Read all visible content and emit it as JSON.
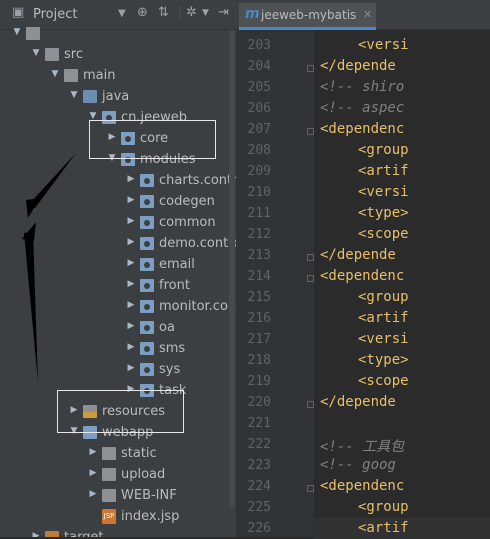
{
  "project_panel": {
    "title": "Project",
    "tree": [
      {
        "label": "",
        "indent": 0,
        "arrow": "down",
        "icon": "folder"
      },
      {
        "label": "src",
        "indent": 1,
        "arrow": "down",
        "icon": "folder"
      },
      {
        "label": "main",
        "indent": 2,
        "arrow": "down",
        "icon": "folder"
      },
      {
        "label": "java",
        "indent": 3,
        "arrow": "down",
        "icon": "folder-source"
      },
      {
        "label": "cn.jeeweb",
        "indent": 4,
        "arrow": "down",
        "icon": "package"
      },
      {
        "label": "core",
        "indent": 5,
        "arrow": "right",
        "icon": "package"
      },
      {
        "label": "modules",
        "indent": 5,
        "arrow": "down",
        "icon": "package"
      },
      {
        "label": "charts.contro",
        "indent": 6,
        "arrow": "right",
        "icon": "package"
      },
      {
        "label": "codegen",
        "indent": 6,
        "arrow": "right",
        "icon": "package"
      },
      {
        "label": "common",
        "indent": 6,
        "arrow": "right",
        "icon": "package"
      },
      {
        "label": "demo.contro",
        "indent": 6,
        "arrow": "right",
        "icon": "package"
      },
      {
        "label": "email",
        "indent": 6,
        "arrow": "right",
        "icon": "package"
      },
      {
        "label": "front",
        "indent": 6,
        "arrow": "right",
        "icon": "package"
      },
      {
        "label": "monitor.con",
        "indent": 6,
        "arrow": "right",
        "icon": "package"
      },
      {
        "label": "oa",
        "indent": 6,
        "arrow": "right",
        "icon": "package"
      },
      {
        "label": "sms",
        "indent": 6,
        "arrow": "right",
        "icon": "package"
      },
      {
        "label": "sys",
        "indent": 6,
        "arrow": "right",
        "icon": "package"
      },
      {
        "label": "task",
        "indent": 6,
        "arrow": "right",
        "icon": "package"
      },
      {
        "label": "resources",
        "indent": 3,
        "arrow": "right",
        "icon": "folder-resources"
      },
      {
        "label": "webapp",
        "indent": 3,
        "arrow": "down",
        "icon": "folder-web"
      },
      {
        "label": "static",
        "indent": 4,
        "arrow": "right",
        "icon": "folder"
      },
      {
        "label": "upload",
        "indent": 4,
        "arrow": "right",
        "icon": "folder"
      },
      {
        "label": "WEB-INF",
        "indent": 4,
        "arrow": "right",
        "icon": "folder"
      },
      {
        "label": "index.jsp",
        "indent": 4,
        "arrow": "none",
        "icon": "jsp-file"
      },
      {
        "label": "target",
        "indent": 1,
        "arrow": "right",
        "icon": "folder-excluded"
      }
    ]
  },
  "editor": {
    "tab_label": "jeeweb-mybatis",
    "tab_icon_letter": "m",
    "lines": [
      {
        "n": "203",
        "indent": 2,
        "text": "<versi",
        "kind": "tag"
      },
      {
        "n": "204",
        "indent": 1,
        "text": "</depende",
        "kind": "tag"
      },
      {
        "n": "205",
        "indent": 1,
        "text": "<!-- shiro",
        "kind": "comment"
      },
      {
        "n": "206",
        "indent": 1,
        "text": "<!-- aspec",
        "kind": "comment"
      },
      {
        "n": "207",
        "indent": 1,
        "text": "<dependenc",
        "kind": "tag"
      },
      {
        "n": "208",
        "indent": 2,
        "text": "<group",
        "kind": "tag"
      },
      {
        "n": "209",
        "indent": 2,
        "text": "<artif",
        "kind": "tag"
      },
      {
        "n": "210",
        "indent": 2,
        "text": "<versi",
        "kind": "tag"
      },
      {
        "n": "211",
        "indent": 2,
        "text": "<type>",
        "kind": "tag"
      },
      {
        "n": "212",
        "indent": 2,
        "text": "<scope",
        "kind": "tag"
      },
      {
        "n": "213",
        "indent": 1,
        "text": "</depende",
        "kind": "tag"
      },
      {
        "n": "214",
        "indent": 1,
        "text": "<dependenc",
        "kind": "tag"
      },
      {
        "n": "215",
        "indent": 2,
        "text": "<group",
        "kind": "tag"
      },
      {
        "n": "216",
        "indent": 2,
        "text": "<artif",
        "kind": "tag"
      },
      {
        "n": "217",
        "indent": 2,
        "text": "<versi",
        "kind": "tag"
      },
      {
        "n": "218",
        "indent": 2,
        "text": "<type>",
        "kind": "tag"
      },
      {
        "n": "219",
        "indent": 2,
        "text": "<scope",
        "kind": "tag"
      },
      {
        "n": "220",
        "indent": 1,
        "text": "</depende",
        "kind": "tag"
      },
      {
        "n": "221",
        "indent": 0,
        "text": "",
        "kind": "blank"
      },
      {
        "n": "222",
        "indent": 1,
        "text": "<!-- 工具包",
        "kind": "comment"
      },
      {
        "n": "223",
        "indent": 1,
        "text": "<!-- goog",
        "kind": "comment"
      },
      {
        "n": "224",
        "indent": 1,
        "text": "<dependenc",
        "kind": "tag"
      },
      {
        "n": "225",
        "indent": 2,
        "text": "<group",
        "kind": "tag"
      },
      {
        "n": "226",
        "indent": 2,
        "text": "<artif",
        "kind": "tag"
      }
    ]
  }
}
